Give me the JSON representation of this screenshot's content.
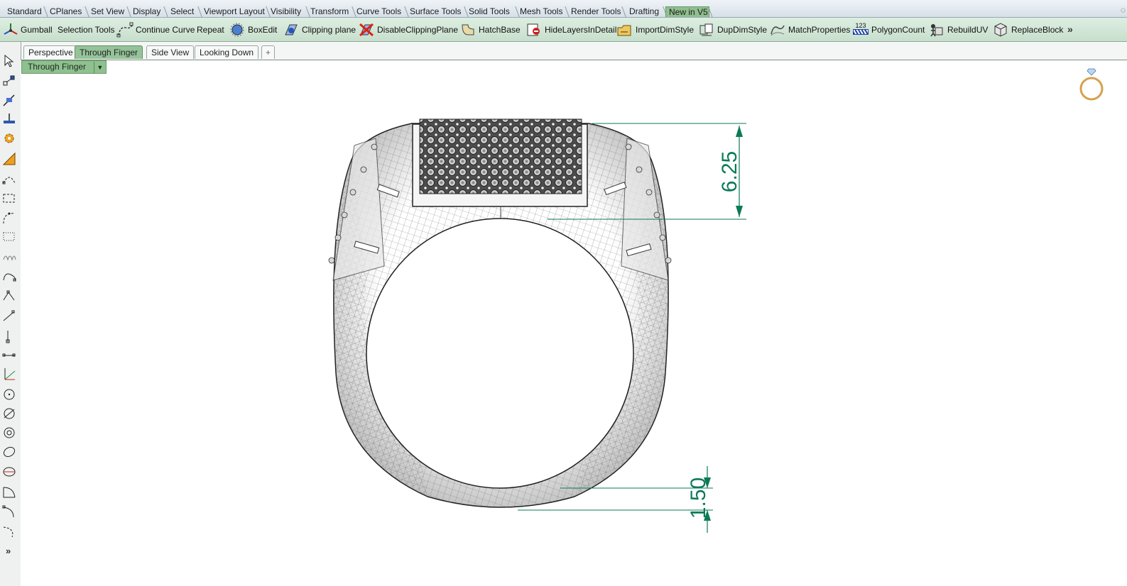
{
  "toolbar_tabs": [
    "Standard",
    "CPlanes",
    "Set View",
    "Display",
    "Select",
    "Viewport Layout",
    "Visibility",
    "Transform",
    "Curve Tools",
    "Surface Tools",
    "Solid Tools",
    "Mesh Tools",
    "Render Tools",
    "Drafting",
    "New in V5"
  ],
  "toolbar_tabs_active": "New in V5",
  "toolbar_tabs_overflow": "◌",
  "commands": [
    {
      "label": "Gumball",
      "icon": "gumball-icon"
    },
    {
      "label": "Selection Tools",
      "icon": ""
    },
    {
      "label": "Continue Curve",
      "icon": "continue-curve-icon"
    },
    {
      "label": "Repeat",
      "icon": ""
    },
    {
      "label": "BoxEdit",
      "icon": "boxedit-icon"
    },
    {
      "label": "Clipping plane",
      "icon": "clipping-plane-icon"
    },
    {
      "label": "DisableClippingPlane",
      "icon": "disable-clipping-plane-icon"
    },
    {
      "label": "HatchBase",
      "icon": "hatchbase-icon"
    },
    {
      "label": "HideLayersInDetail",
      "icon": "hide-layers-icon"
    },
    {
      "label": "ImportDimStyle",
      "icon": "import-dimstyle-icon"
    },
    {
      "label": "DupDimStyle",
      "icon": "dup-dimstyle-icon"
    },
    {
      "label": "MatchProperties",
      "icon": "match-properties-icon"
    },
    {
      "label": "PolygonCount",
      "icon": "polygon-count-icon",
      "icon_text": "123"
    },
    {
      "label": "RebuildUV",
      "icon": "rebuild-uv-icon"
    },
    {
      "label": "ReplaceBlock",
      "icon": "replace-block-icon"
    }
  ],
  "commands_more": "»",
  "viewport_tabs": [
    "Perspective",
    "Through Finger",
    "Side View",
    "Looking Down",
    "+"
  ],
  "viewport_tabs_active": "Through Finger",
  "viewport": {
    "title": "Through Finger",
    "dropdown_glyph": "▼",
    "dimensions": [
      {
        "value": "6.25"
      },
      {
        "value": "1.50"
      }
    ]
  },
  "left_toolbar_more": "»",
  "colors": {
    "active_tab": "#8fbf8e",
    "dimension": "#0b7a57",
    "toolbar_bg": "#d4e7d8"
  }
}
